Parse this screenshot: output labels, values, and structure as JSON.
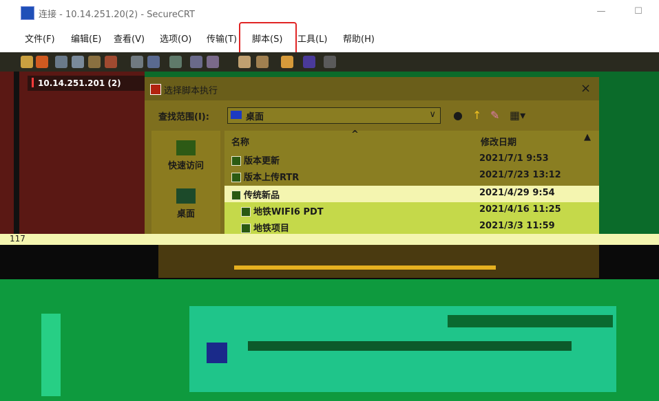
{
  "window": {
    "title": "连接 - 10.14.251.20(2) - SecureCRT",
    "min_glyph": "—",
    "max_glyph": "☐"
  },
  "menu": [
    {
      "id": "file",
      "label": "文件(F)"
    },
    {
      "id": "edit",
      "label": "编辑(E)"
    },
    {
      "id": "view",
      "label": "查看(V)"
    },
    {
      "id": "options",
      "label": "选项(O)"
    },
    {
      "id": "transfer",
      "label": "传输(T)"
    },
    {
      "id": "script",
      "label": "脚本(S)"
    },
    {
      "id": "tools",
      "label": "工具(L)"
    },
    {
      "id": "help",
      "label": "帮助(H)"
    }
  ],
  "session": {
    "tab_label": "10.14.251.201 (2)",
    "counter": "117"
  },
  "dialog": {
    "title": "选择脚本执行",
    "close_glyph": "×",
    "lookin_label": "查找范围(I):",
    "lookin_value": "桌面",
    "combo_caret": "∨",
    "places": [
      {
        "id": "quick-access",
        "label": "快速访问"
      },
      {
        "id": "desktop",
        "label": "桌面"
      }
    ],
    "columns": {
      "name": "名称",
      "date": "修改日期"
    },
    "files": [
      {
        "name": "版本更新",
        "date": "2021/7/1 9:53"
      },
      {
        "name": "版本上传RTR",
        "date": "2021/7/23 13:12"
      },
      {
        "name": "传统新品",
        "date": "2021/4/29 9:54"
      },
      {
        "name": "地铁WIFI6 PDT",
        "date": "2021/4/16 11:25"
      },
      {
        "name": "地铁项目",
        "date": "2021/3/3 11:59"
      }
    ]
  },
  "colors": {
    "highlight_box": "#e02424",
    "dialog_bg": "#7e6f1e",
    "session_bg": "#5a1814",
    "glitch_green": "#0e9a3e",
    "glitch_teal": "#1fc58a"
  }
}
